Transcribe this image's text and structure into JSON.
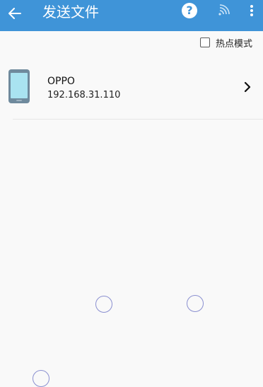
{
  "appbar": {
    "title": "发送文件",
    "back_icon": "arrow-left-icon",
    "help_icon": "question-circle-icon",
    "help_glyph": "?",
    "wifi_icon": "wifi-icon",
    "more_icon": "more-vertical-icon",
    "background": "#3f94d8"
  },
  "hotspot": {
    "label": "热点模式",
    "checked": false
  },
  "devices": [
    {
      "name": "OPPO",
      "ip": "192.168.31.110",
      "icon": "phone-icon"
    }
  ],
  "colors": {
    "accent": "#3f94d8",
    "phone_screen": "#a9e3f1",
    "phone_body": "#6f8a9d"
  }
}
